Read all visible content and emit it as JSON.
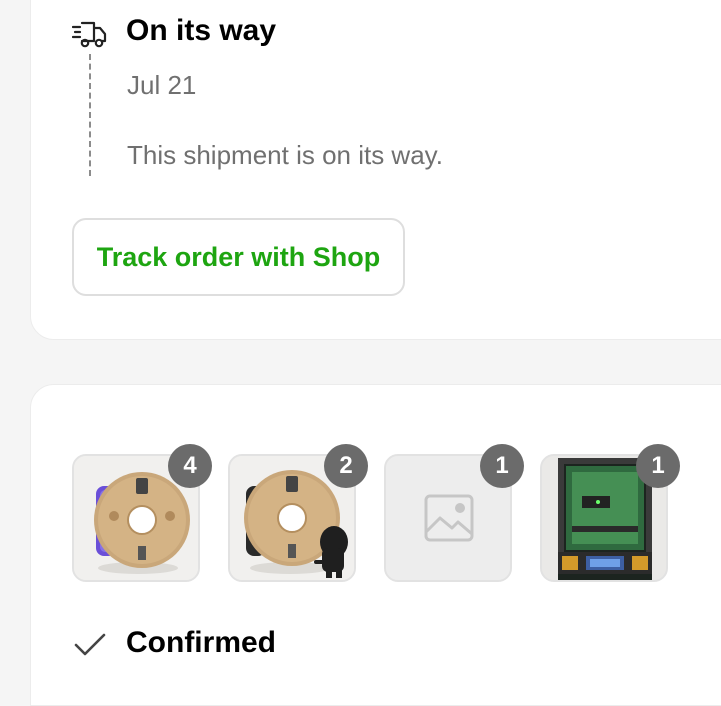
{
  "shipment": {
    "status_title": "On its way",
    "date": "Jul 21",
    "message": "This shipment is on its way.",
    "icon": "delivery-truck-icon"
  },
  "track_button": {
    "label": "Track order with Shop",
    "color": "#1ea511"
  },
  "items": [
    {
      "name": "purple-filament-spool",
      "quantity": "4"
    },
    {
      "name": "black-filament-spool",
      "quantity": "2"
    },
    {
      "name": "image-placeholder",
      "quantity": "1"
    },
    {
      "name": "3d-printer",
      "quantity": "1"
    }
  ],
  "confirmed": {
    "title": "Confirmed",
    "icon": "checkmark-icon"
  },
  "colors": {
    "badge": "#6b6b6b",
    "muted_text": "#707070",
    "background": "#f5f5f5"
  }
}
